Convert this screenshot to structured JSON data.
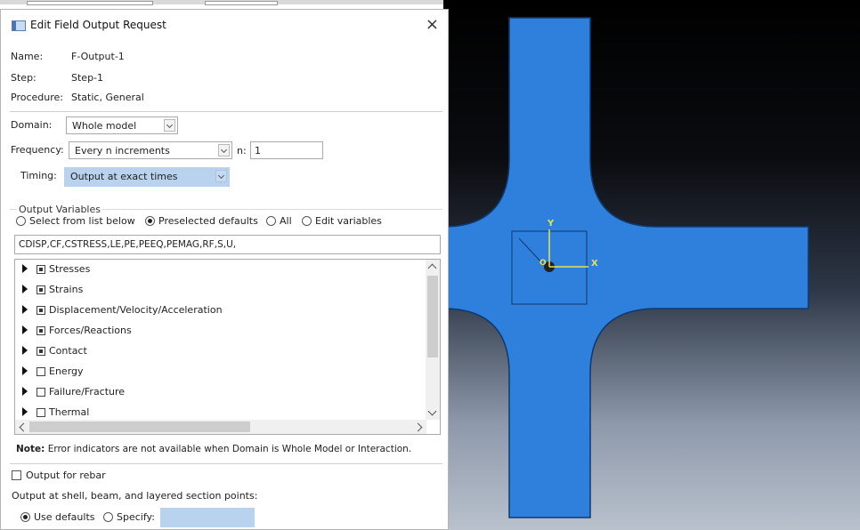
{
  "dialog": {
    "title": "Edit Field Output Request",
    "close_glyph": "×",
    "name_label": "Name:",
    "name_value": "F-Output-1",
    "step_label": "Step:",
    "step_value": "Step-1",
    "procedure_label": "Procedure:",
    "procedure_value": "Static, General",
    "domain_label": "Domain:",
    "domain_value": "Whole model",
    "frequency_label": "Frequency:",
    "frequency_value": "Every n increments",
    "n_label": "n:",
    "n_value": "1",
    "timing_label": "Timing:",
    "timing_value": "Output at exact times",
    "output_variables": {
      "group_title": "Output Variables",
      "options": [
        "Select from list below",
        "Preselected defaults",
        "All",
        "Edit variables"
      ],
      "selected": "Preselected defaults",
      "variables_text": "CDISP,CF,CSTRESS,LE,PE,PEEQ,PEMAG,RF,S,U,",
      "tree_items": [
        {
          "label": "Stresses",
          "state": "partial"
        },
        {
          "label": "Strains",
          "state": "partial"
        },
        {
          "label": "Displacement/Velocity/Acceleration",
          "state": "partial"
        },
        {
          "label": "Forces/Reactions",
          "state": "partial"
        },
        {
          "label": "Contact",
          "state": "partial"
        },
        {
          "label": "Energy",
          "state": "unchecked"
        },
        {
          "label": "Failure/Fracture",
          "state": "unchecked"
        },
        {
          "label": "Thermal",
          "state": "unchecked"
        }
      ]
    },
    "note_label": "Note:",
    "note_text": "Error indicators are not available when Domain is Whole Model or Interaction.",
    "output_for_rebar": "Output for rebar",
    "section_points_label": "Output at shell, beam, and layered section points:",
    "use_defaults": "Use defaults",
    "specify": "Specify:"
  },
  "viewport": {
    "axis_y": "Y",
    "axis_x": "X",
    "axis_origin": "O",
    "model_color": "#2f7fdc",
    "axis_color": "#e3e35a"
  }
}
